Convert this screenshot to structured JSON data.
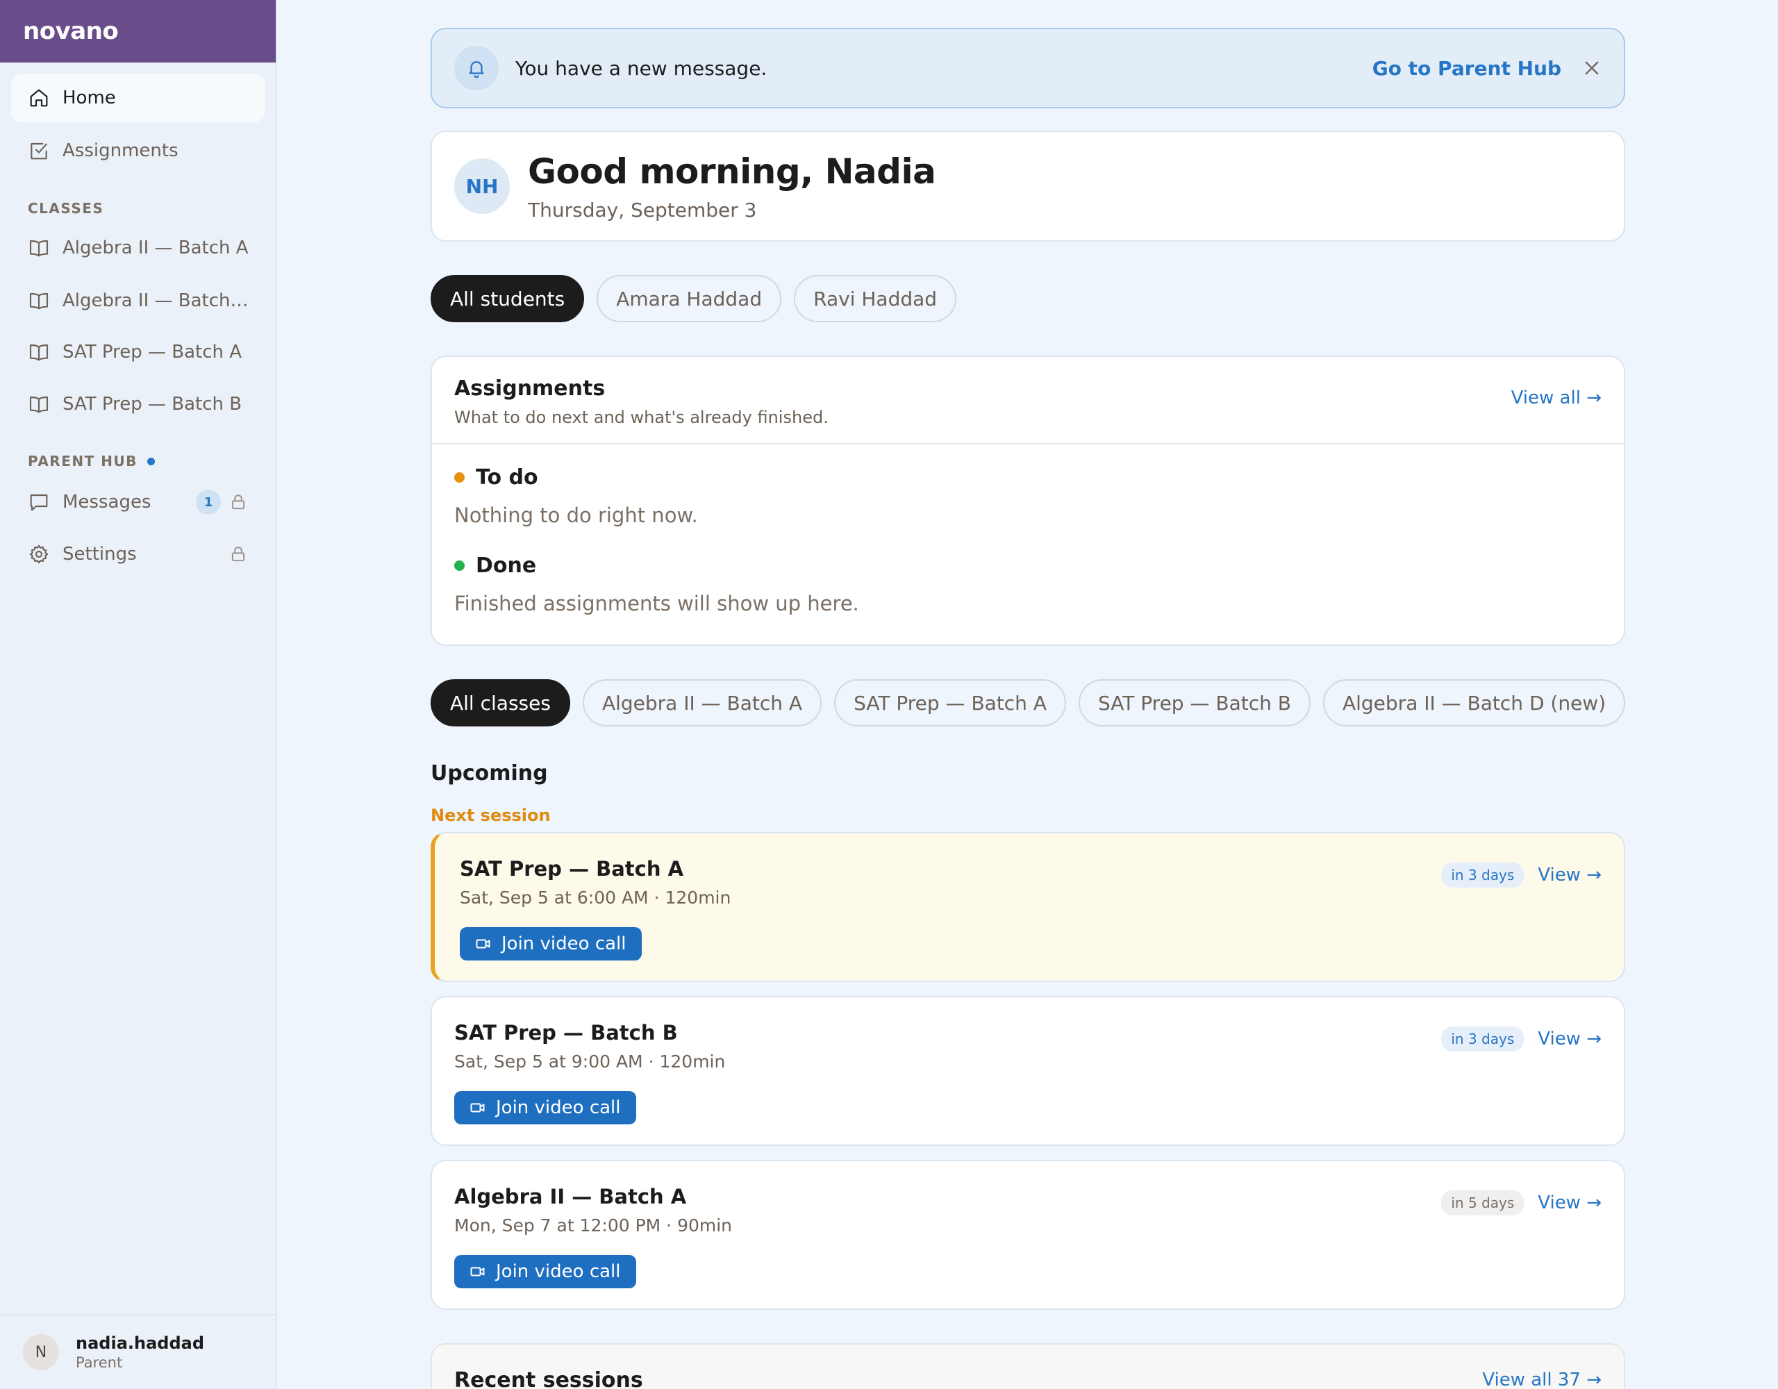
{
  "brand": "novano",
  "sidebar": {
    "nav": [
      {
        "label": "Home",
        "icon": "home-icon",
        "active": true
      },
      {
        "label": "Assignments",
        "icon": "checkbox-icon"
      }
    ],
    "classes_heading": "CLASSES",
    "classes": [
      {
        "label": "Algebra II — Batch A"
      },
      {
        "label": "Algebra II — Batch D (new)"
      },
      {
        "label": "SAT Prep — Batch A"
      },
      {
        "label": "SAT Prep — Batch B"
      }
    ],
    "parent_hub_heading": "PARENT HUB",
    "parent_hub": [
      {
        "label": "Messages",
        "badge": "1",
        "locked": true
      },
      {
        "label": "Settings",
        "locked": true
      }
    ],
    "user": {
      "initial": "N",
      "name": "nadia.haddad",
      "role": "Parent"
    }
  },
  "banner": {
    "text": "You have a new message.",
    "link": "Go to Parent Hub"
  },
  "greeting": {
    "initials": "NH",
    "title": "Good morning, Nadia",
    "date": "Thursday, September 3"
  },
  "student_filters": [
    "All students",
    "Amara Haddad",
    "Ravi Haddad"
  ],
  "assignments": {
    "title": "Assignments",
    "subtitle": "What to do next and what's already finished.",
    "view_all": "View all →",
    "todo_label": "To do",
    "todo_empty": "Nothing to do right now.",
    "done_label": "Done",
    "done_empty": "Finished assignments will show up here."
  },
  "class_filters": [
    "All classes",
    "Algebra II — Batch A",
    "SAT Prep — Batch A",
    "SAT Prep — Batch B",
    "Algebra II — Batch D (new)"
  ],
  "upcoming": {
    "title": "Upcoming",
    "next_label": "Next session",
    "sessions": [
      {
        "title": "SAT Prep — Batch A",
        "meta": "Sat, Sep 5 at 6:00 AM · 120min",
        "when": "in 3 days",
        "view": "View →",
        "join": "Join video call"
      },
      {
        "title": "SAT Prep — Batch B",
        "meta": "Sat, Sep 5 at 9:00 AM · 120min",
        "when": "in 3 days",
        "view": "View →",
        "join": "Join video call"
      },
      {
        "title": "Algebra II — Batch A",
        "meta": "Mon, Sep 7 at 12:00 PM · 90min",
        "when": "in 5 days",
        "view": "View →",
        "join": "Join video call"
      }
    ]
  },
  "recent": {
    "title": "Recent sessions",
    "view_all": "View all 37 →"
  },
  "colors": {
    "brand": "#6a4c8a",
    "accent": "#2775c5",
    "todo": "#e8900f",
    "done": "#22b14c",
    "highlight": "#fdfaea"
  }
}
